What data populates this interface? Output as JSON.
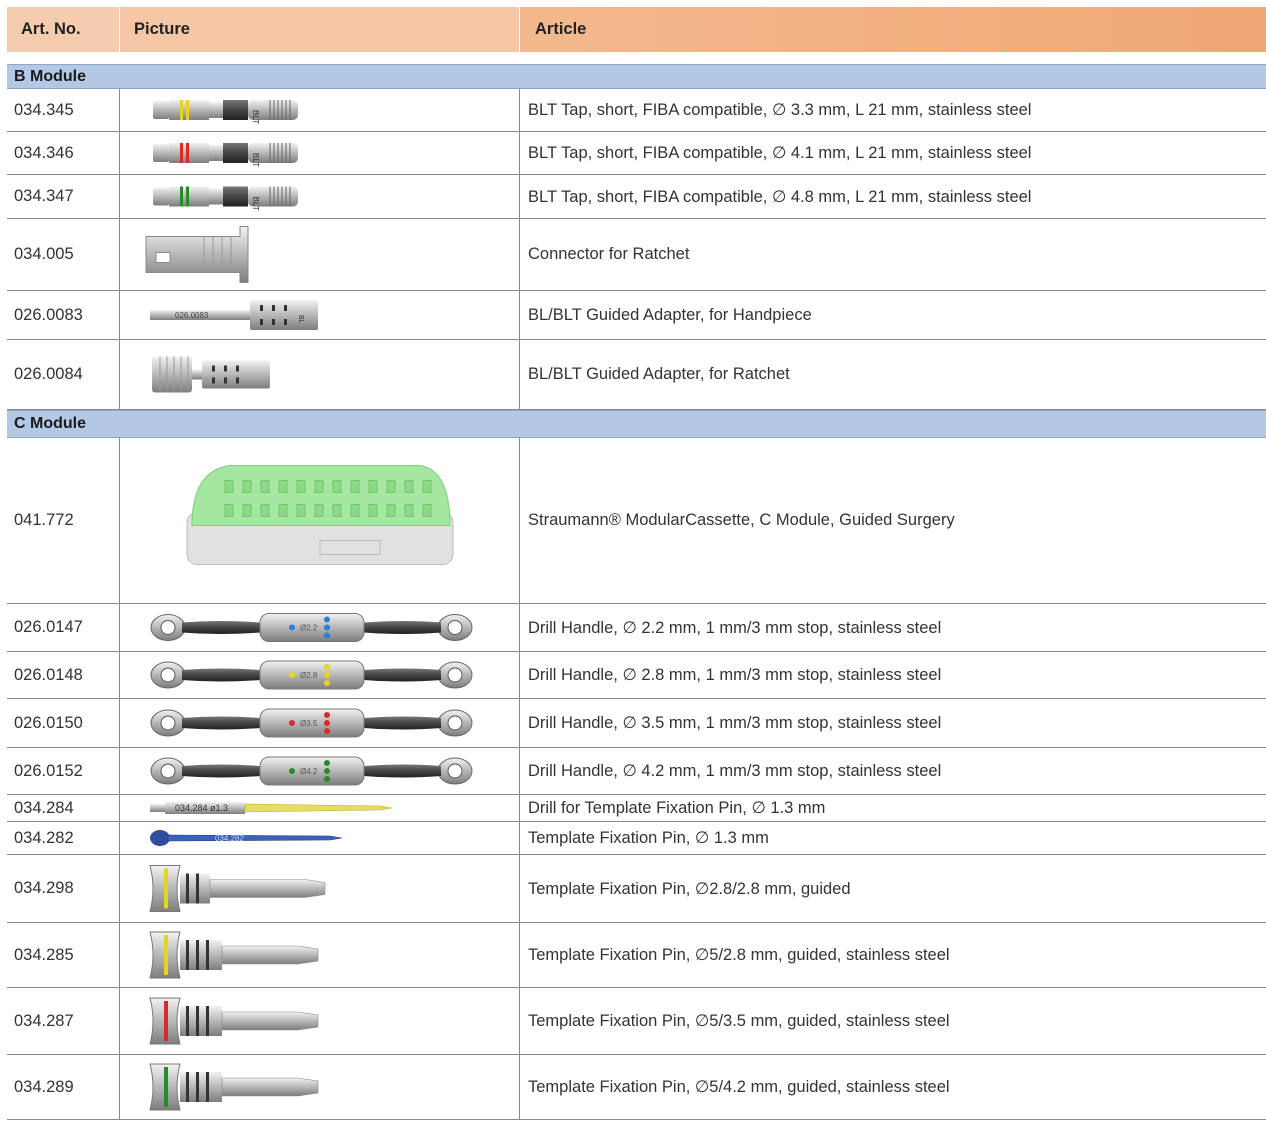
{
  "header": {
    "art_no": "Art. No.",
    "picture": "Picture",
    "article": "Article"
  },
  "sections": [
    {
      "title": "B Module",
      "rows": [
        {
          "art": "034.345",
          "article": "BLT Tap, short, FIBA compatible, ∅ 3.3 mm, L 21 mm, stainless steel",
          "image": "tap-yellow",
          "ring_color": "#e7d21d"
        },
        {
          "art": "034.346",
          "article": "BLT Tap, short, FIBA compatible, ∅ 4.1 mm, L 21 mm, stainless steel",
          "image": "tap-red",
          "ring_color": "#d62b2b"
        },
        {
          "art": "034.347",
          "article": "BLT Tap, short, FIBA compatible, ∅ 4.8 mm, L 21 mm, stainless steel",
          "image": "tap-green",
          "ring_color": "#2a8a2a"
        },
        {
          "art": "034.005",
          "article": "Connector for Ratchet",
          "image": "connector"
        },
        {
          "art": "026.0083",
          "article": "BL/BLT Guided Adapter, for Handpiece",
          "image": "adapter-handpiece",
          "engraving": "026.0083"
        },
        {
          "art": "026.0084",
          "article": "BL/BLT Guided Adapter, for Ratchet",
          "image": "adapter-ratchet"
        }
      ]
    },
    {
      "title": "C Module",
      "rows": [
        {
          "art": "041.772",
          "article": "Straumann® ModularCassette, C Module, Guided Surgery",
          "image": "cassette"
        },
        {
          "art": "026.0147",
          "article": "Drill Handle, ∅ 2.2 mm, 1 mm/3 mm stop, stainless steel",
          "image": "drill-handle",
          "ring_color": "#2a7fd4",
          "engraving": "Ø2.2"
        },
        {
          "art": "026.0148",
          "article": "Drill Handle, ∅ 2.8 mm, 1 mm/3 mm stop, stainless steel",
          "image": "drill-handle",
          "ring_color": "#e7d21d",
          "engraving": "Ø2.8"
        },
        {
          "art": "026.0150",
          "article": "Drill Handle, ∅ 3.5 mm, 1 mm/3 mm stop, stainless steel",
          "image": "drill-handle",
          "ring_color": "#d62b2b",
          "engraving": "Ø3.5"
        },
        {
          "art": "026.0152",
          "article": "Drill Handle, ∅ 4.2 mm, 1 mm/3 mm stop, stainless steel",
          "image": "drill-handle",
          "ring_color": "#2a8a2a",
          "engraving": "Ø4.2"
        },
        {
          "art": "034.284",
          "article": "Drill for Template Fixation Pin, ∅ 1.3 mm",
          "image": "drill-thin",
          "engraving": "034.284 ø1.3"
        },
        {
          "art": "034.282",
          "article": "Template Fixation Pin, ∅ 1.3 mm",
          "image": "pin-blue",
          "engraving": "034.282"
        },
        {
          "art": "034.298",
          "article": "Template Fixation Pin, ∅2.8/2.8 mm, guided",
          "image": "pin-guided-long",
          "ring_color": "#e7d21d"
        },
        {
          "art": "034.285",
          "article": "Template Fixation Pin, ∅5/2.8 mm, guided, stainless steel",
          "image": "pin-guided",
          "ring_color": "#e7d21d"
        },
        {
          "art": "034.287",
          "article": "Template Fixation Pin, ∅5/3.5 mm, guided, stainless steel",
          "image": "pin-guided",
          "ring_color": "#d62b2b"
        },
        {
          "art": "034.289",
          "article": "Template Fixation Pin, ∅5/4.2 mm, guided, stainless steel",
          "image": "pin-guided",
          "ring_color": "#2a8a2a"
        }
      ]
    }
  ]
}
